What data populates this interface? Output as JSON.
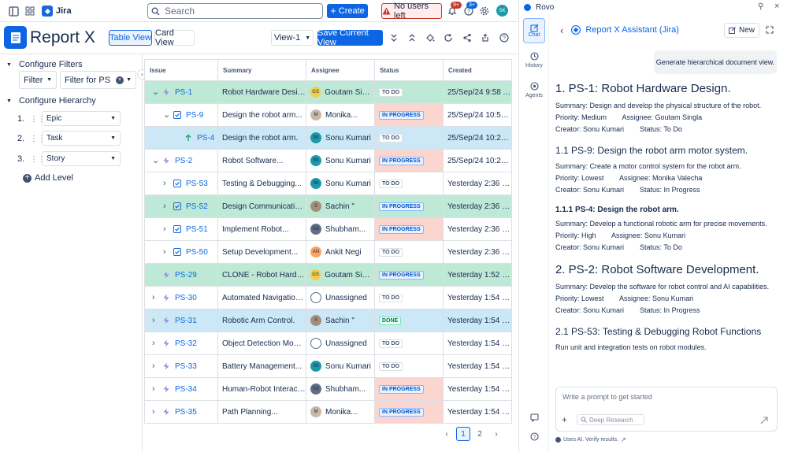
{
  "topbar": {
    "app_name": "Jira",
    "search_placeholder": "Search",
    "create_label": "Create",
    "no_users_label": "No users left",
    "notif_badge": "9+",
    "help_badge": "3+",
    "avatar_initials": "SK"
  },
  "report": {
    "title": "Report X",
    "table_view": "Table View",
    "card_view": "Card View",
    "view_select": "View-1",
    "save_view": "Save Current View"
  },
  "left": {
    "configure_filters": "Configure Filters",
    "filter_label": "Filter",
    "filter_value": "Filter for PS ...",
    "configure_hierarchy": "Configure Hierarchy",
    "levels": [
      {
        "num": "1.",
        "label": "Epic"
      },
      {
        "num": "2.",
        "label": "Task"
      },
      {
        "num": "3.",
        "label": "Story"
      }
    ],
    "add_level": "Add Level"
  },
  "table": {
    "headers": [
      "Issue",
      "Summary",
      "Assignee",
      "Status",
      "Created"
    ],
    "rows": [
      {
        "key": "PS-1",
        "indent": 0,
        "chev": "v",
        "type": "epic",
        "summary": "Robot Hardware Design.",
        "assignee": "Goutam Singla",
        "initials": "GS",
        "avcolor": "#f5cd47",
        "status": "TO DO",
        "created": "25/Sep/24 9:58 AM",
        "hl": "green"
      },
      {
        "key": "PS-9",
        "indent": 1,
        "chev": "v",
        "type": "task",
        "summary": "Design the robot arm...",
        "assignee": "Monika...",
        "initials": "M",
        "avcolor": "#c9b8a6",
        "status": "IN PROGRESS",
        "created": "25/Sep/24 10:50...",
        "hl": ""
      },
      {
        "key": "PS-4",
        "indent": 2,
        "chev": "",
        "type": "story",
        "summary": "Design the robot arm.",
        "assignee": "Sonu Kumari",
        "initials": "SK",
        "avcolor": "#1d9aaa",
        "status": "TO DO",
        "created": "25/Sep/24 10:22 AM",
        "hl": "blue"
      },
      {
        "key": "PS-2",
        "indent": 0,
        "chev": "v",
        "type": "epic",
        "summary": "Robot Software...",
        "assignee": "Sonu Kumari",
        "initials": "SK",
        "avcolor": "#1d9aaa",
        "status": "IN PROGRESS",
        "created": "25/Sep/24 10:20 AM",
        "hl": ""
      },
      {
        "key": "PS-53",
        "indent": 1,
        "chev": ">",
        "type": "task",
        "summary": "Testing & Debugging...",
        "assignee": "Sonu Kumari",
        "initials": "SK",
        "avcolor": "#1d9aaa",
        "status": "TO DO",
        "created": "Yesterday 2:36 PM",
        "hl": ""
      },
      {
        "key": "PS-52",
        "indent": 1,
        "chev": ">",
        "type": "task",
        "summary": "Design Communication...",
        "assignee": "Sachin \"",
        "initials": "S",
        "avcolor": "#a58f7a",
        "status": "IN PROGRESS",
        "created": "Yesterday 2:36 PM",
        "hl": "green"
      },
      {
        "key": "PS-51",
        "indent": 1,
        "chev": ">",
        "type": "task",
        "summary": "Implement Robot...",
        "assignee": "Shubham...",
        "initials": "SG",
        "avcolor": "#626f86",
        "status": "IN PROGRESS",
        "created": "Yesterday 2:36 PM",
        "hl": ""
      },
      {
        "key": "PS-50",
        "indent": 1,
        "chev": ">",
        "type": "task",
        "summary": "Setup Development...",
        "assignee": "Ankit Negi",
        "initials": "AN",
        "avcolor": "#fea362",
        "status": "TO DO",
        "created": "Yesterday 2:36 PM",
        "hl": ""
      },
      {
        "key": "PS-29",
        "indent": 0,
        "chev": "",
        "type": "epic",
        "summary": "CLONE - Robot Hardwar...",
        "assignee": "Goutam Singla",
        "initials": "GS",
        "avcolor": "#f5cd47",
        "status": "IN PROGRESS",
        "created": "Yesterday 1:52 PM",
        "hl": "green"
      },
      {
        "key": "PS-30",
        "indent": 0,
        "chev": ">",
        "type": "epic",
        "summary": "Automated Navigation...",
        "assignee": "Unassigned",
        "initials": "",
        "avcolor": "#dcdfe4",
        "status": "TO DO",
        "created": "Yesterday 1:54 PM",
        "hl": ""
      },
      {
        "key": "PS-31",
        "indent": 0,
        "chev": ">",
        "type": "epic",
        "summary": "Robotic Arm Control.",
        "assignee": "Sachin \"",
        "initials": "S",
        "avcolor": "#a58f7a",
        "status": "DONE",
        "created": "Yesterday 1:54 PM",
        "hl": "blue"
      },
      {
        "key": "PS-32",
        "indent": 0,
        "chev": ">",
        "type": "epic",
        "summary": "Object Detection Module",
        "assignee": "Unassigned",
        "initials": "",
        "avcolor": "#dcdfe4",
        "status": "TO DO",
        "created": "Yesterday 1:54 PM",
        "hl": ""
      },
      {
        "key": "PS-33",
        "indent": 0,
        "chev": ">",
        "type": "epic",
        "summary": "Battery Management...",
        "assignee": "Sonu Kumari",
        "initials": "SK",
        "avcolor": "#1d9aaa",
        "status": "TO DO",
        "created": "Yesterday 1:54 PM",
        "hl": ""
      },
      {
        "key": "PS-34",
        "indent": 0,
        "chev": ">",
        "type": "epic",
        "summary": "Human-Robot Interaction",
        "assignee": "Shubham...",
        "initials": "SG",
        "avcolor": "#626f86",
        "status": "IN PROGRESS",
        "created": "Yesterday 1:54 PM",
        "hl": ""
      },
      {
        "key": "PS-35",
        "indent": 0,
        "chev": ">",
        "type": "epic",
        "summary": "Path Planning...",
        "assignee": "Monika...",
        "initials": "M",
        "avcolor": "#c9b8a6",
        "status": "IN PROGRESS",
        "created": "Yesterday 1:54 PM",
        "hl": ""
      }
    ],
    "pages": [
      "1",
      "2"
    ]
  },
  "rovo": {
    "brand": "Rovo",
    "nav": {
      "chat": "Chat",
      "history": "History",
      "agents": "Agents"
    },
    "assistant": "Report X Assistant (Jira)",
    "new_label": "New",
    "user_message": "Generate hierarchical document view.",
    "sections": [
      {
        "level": "h1",
        "title": "1. PS-1: Robot Hardware Design.",
        "lines": [
          "Summary: Design and develop the physical structure of the robot.",
          "Priority: Medium        Assignee: Goutam Singla",
          "Creator: Sonu Kumari        Status: To Do"
        ]
      },
      {
        "level": "h2",
        "title": "1.1 PS-9: Design the robot arm motor system.",
        "lines": [
          "Summary: Create a motor control system for the robot arm.",
          "Priority: Lowest        Assignee: Monika Valecha",
          "Creator: Sonu Kumari        Status: In Progress"
        ]
      },
      {
        "level": "h3",
        "title": "1.1.1 PS-4: Design the robot arm.",
        "lines": [
          "Summary: Develop a functional robotic arm for precise movements.",
          "Priority: High        Assignee: Sonu Kumari",
          "Creator: Sonu Kumari        Status: To Do"
        ]
      },
      {
        "level": "h1",
        "title": "2. PS-2: Robot Software Development.",
        "lines": [
          "Summary: Develop the software for robot control and AI capabilities.",
          "Priority: Lowest        Assignee: Sonu Kumari",
          "Creator: Sonu Kumari        Status: In Progress"
        ]
      },
      {
        "level": "h2",
        "title": "2.1 PS-53: Testing & Debugging Robot Functions",
        "lines": [
          "Run unit and integration tests on robot modules."
        ]
      }
    ],
    "prompt_placeholder": "Write a prompt to get started",
    "deep_research": "Deep Research",
    "disclaimer": "Uses AI. Verify results."
  }
}
